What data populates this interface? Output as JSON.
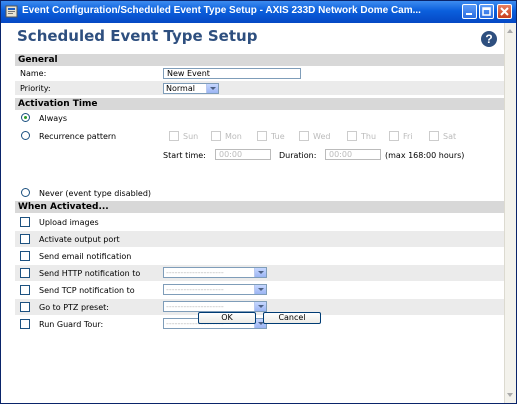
{
  "window": {
    "title": "Event Configuration/Scheduled Event Type Setup - AXIS 233D Network Dome Cam..."
  },
  "page_title": "Scheduled Event Type Setup",
  "help_label": "?",
  "general": {
    "section_label": "General",
    "name_label": "Name:",
    "name_value": "New Event",
    "priority_label": "Priority:",
    "priority_value": "Normal"
  },
  "activation": {
    "section_label": "Activation Time",
    "always_label": "Always",
    "recurrence_label": "Recurrence pattern",
    "days": [
      "Sun",
      "Mon",
      "Tue",
      "Wed",
      "Thu",
      "Fri",
      "Sat"
    ],
    "start_time_label": "Start time:",
    "start_time_value": "00:00",
    "duration_label": "Duration:",
    "duration_value": "00:00",
    "max_note": "(max 168:00 hours)",
    "never_label": "Never (event type disabled)"
  },
  "when_activated": {
    "section_label": "When Activated...",
    "upload_label": "Upload images",
    "output_label": "Activate output port",
    "email_label": "Send email notification",
    "http_label": "Send HTTP notification to",
    "tcp_label": "Send TCP notification to",
    "ptz_label": "Go to PTZ preset:",
    "guard_label": "Run Guard Tour:",
    "select_placeholder": "--------------------"
  },
  "buttons": {
    "ok": "OK",
    "cancel": "Cancel"
  },
  "colors": {
    "title_bar": "#0b5fdc",
    "heading": "#2e4f7f",
    "section_bg": "#d8d8d8"
  }
}
